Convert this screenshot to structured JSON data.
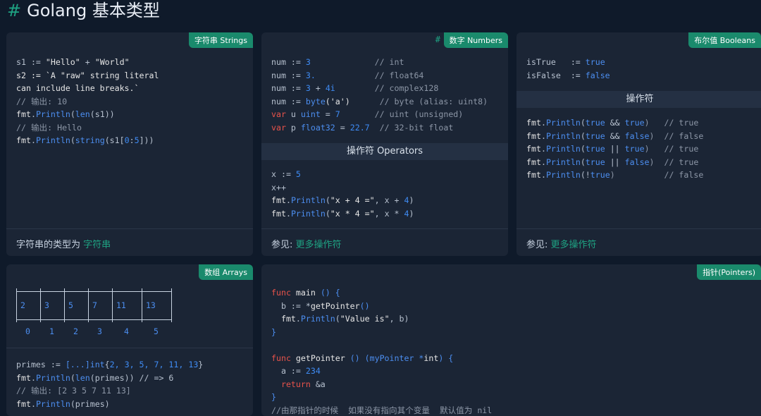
{
  "page_title": "Golang 基本类型",
  "page_title_hash": "#",
  "cards": {
    "strings": {
      "tag": "字符串 Strings",
      "code": [
        [
          {
            "t": "s1 := ",
            "c": "p"
          },
          {
            "t": "\"Hello\"",
            "c": "s"
          },
          {
            "t": " + ",
            "c": "p"
          },
          {
            "t": "\"World\"",
            "c": "s"
          }
        ],
        [
          {
            "t": "s2 := `A \"raw\" string literal",
            "c": "s"
          }
        ],
        [
          {
            "t": "can include line breaks.`",
            "c": "s"
          }
        ],
        [
          {
            "t": "// 输出: 10",
            "c": "c"
          }
        ],
        [
          {
            "t": "fmt",
            "c": "s"
          },
          {
            "t": ".",
            "c": "p"
          },
          {
            "t": "Println",
            "c": "f"
          },
          {
            "t": "(",
            "c": "p"
          },
          {
            "t": "len",
            "c": "f"
          },
          {
            "t": "(s1))",
            "c": "p"
          }
        ],
        [
          {
            "t": "// 输出: Hello",
            "c": "c"
          }
        ],
        [
          {
            "t": "fmt",
            "c": "s"
          },
          {
            "t": ".",
            "c": "p"
          },
          {
            "t": "Println",
            "c": "f"
          },
          {
            "t": "(",
            "c": "p"
          },
          {
            "t": "string",
            "c": "f"
          },
          {
            "t": "(s1[",
            "c": "p"
          },
          {
            "t": "0",
            "c": "n"
          },
          {
            "t": ":",
            "c": "p"
          },
          {
            "t": "5",
            "c": "n"
          },
          {
            "t": "]))",
            "c": "p"
          }
        ]
      ],
      "footer_text": "字符串的类型为 ",
      "footer_link": "字符串"
    },
    "numbers": {
      "tag": "数字 Numbers",
      "tag_hash": "#",
      "code": [
        [
          {
            "t": "num := ",
            "c": "p"
          },
          {
            "t": "3",
            "c": "n"
          },
          {
            "t": "             // int",
            "c": "c"
          }
        ],
        [
          {
            "t": "num := ",
            "c": "p"
          },
          {
            "t": "3.",
            "c": "n"
          },
          {
            "t": "            // float64",
            "c": "c"
          }
        ],
        [
          {
            "t": "num := ",
            "c": "p"
          },
          {
            "t": "3",
            "c": "n"
          },
          {
            "t": " + ",
            "c": "p"
          },
          {
            "t": "4i",
            "c": "n"
          },
          {
            "t": "        // complex128",
            "c": "c"
          }
        ],
        [
          {
            "t": "num := ",
            "c": "p"
          },
          {
            "t": "byte",
            "c": "f"
          },
          {
            "t": "('a')",
            "c": "s"
          },
          {
            "t": "      // byte (alias: uint8)",
            "c": "c"
          }
        ],
        [
          {
            "t": "var",
            "c": "k"
          },
          {
            "t": " u ",
            "c": "p"
          },
          {
            "t": "uint",
            "c": "f"
          },
          {
            "t": " = ",
            "c": "p"
          },
          {
            "t": "7",
            "c": "n"
          },
          {
            "t": "       // uint (unsigned)",
            "c": "c"
          }
        ],
        [
          {
            "t": "var",
            "c": "k"
          },
          {
            "t": " p ",
            "c": "p"
          },
          {
            "t": "float32",
            "c": "f"
          },
          {
            "t": " = ",
            "c": "p"
          },
          {
            "t": "22.7",
            "c": "n"
          },
          {
            "t": "  // 32-bit float",
            "c": "c"
          }
        ]
      ],
      "band": "操作符 Operators",
      "code2": [
        [
          {
            "t": "x := ",
            "c": "p"
          },
          {
            "t": "5",
            "c": "n"
          }
        ],
        [
          {
            "t": "x++",
            "c": "p"
          }
        ],
        [
          {
            "t": "fmt",
            "c": "s"
          },
          {
            "t": ".",
            "c": "p"
          },
          {
            "t": "Println",
            "c": "f"
          },
          {
            "t": "(",
            "c": "p"
          },
          {
            "t": "\"x + 4 =\"",
            "c": "s"
          },
          {
            "t": ", x + ",
            "c": "p"
          },
          {
            "t": "4",
            "c": "n"
          },
          {
            "t": ")",
            "c": "p"
          }
        ],
        [
          {
            "t": "fmt",
            "c": "s"
          },
          {
            "t": ".",
            "c": "p"
          },
          {
            "t": "Println",
            "c": "f"
          },
          {
            "t": "(",
            "c": "p"
          },
          {
            "t": "\"x * 4 =\"",
            "c": "s"
          },
          {
            "t": ", x * ",
            "c": "p"
          },
          {
            "t": "4",
            "c": "n"
          },
          {
            "t": ")",
            "c": "p"
          }
        ]
      ],
      "footer_text": "参见: ",
      "footer_link": "更多操作符"
    },
    "booleans": {
      "tag": "布尔值 Booleans",
      "code": [
        [
          {
            "t": "isTrue   := ",
            "c": "p"
          },
          {
            "t": "true",
            "c": "f"
          }
        ],
        [
          {
            "t": "isFalse  := ",
            "c": "p"
          },
          {
            "t": "false",
            "c": "f"
          }
        ]
      ],
      "band": "操作符",
      "code2": [
        [
          {
            "t": "fmt",
            "c": "s"
          },
          {
            "t": ".",
            "c": "p"
          },
          {
            "t": "Println",
            "c": "f"
          },
          {
            "t": "(",
            "c": "p"
          },
          {
            "t": "true",
            "c": "f"
          },
          {
            "t": " && ",
            "c": "p"
          },
          {
            "t": "true",
            "c": "f"
          },
          {
            "t": ")   // true",
            "c": "c"
          }
        ],
        [
          {
            "t": "fmt",
            "c": "s"
          },
          {
            "t": ".",
            "c": "p"
          },
          {
            "t": "Println",
            "c": "f"
          },
          {
            "t": "(",
            "c": "p"
          },
          {
            "t": "true",
            "c": "f"
          },
          {
            "t": " && ",
            "c": "p"
          },
          {
            "t": "false",
            "c": "f"
          },
          {
            "t": ")  // false",
            "c": "c"
          }
        ],
        [
          {
            "t": "fmt",
            "c": "s"
          },
          {
            "t": ".",
            "c": "p"
          },
          {
            "t": "Println",
            "c": "f"
          },
          {
            "t": "(",
            "c": "p"
          },
          {
            "t": "true",
            "c": "f"
          },
          {
            "t": " || ",
            "c": "p"
          },
          {
            "t": "true",
            "c": "f"
          },
          {
            "t": ")   // true",
            "c": "c"
          }
        ],
        [
          {
            "t": "fmt",
            "c": "s"
          },
          {
            "t": ".",
            "c": "p"
          },
          {
            "t": "Println",
            "c": "f"
          },
          {
            "t": "(",
            "c": "p"
          },
          {
            "t": "true",
            "c": "f"
          },
          {
            "t": " || ",
            "c": "p"
          },
          {
            "t": "false",
            "c": "f"
          },
          {
            "t": ")  // true",
            "c": "c"
          }
        ],
        [
          {
            "t": "fmt",
            "c": "s"
          },
          {
            "t": ".",
            "c": "p"
          },
          {
            "t": "Println",
            "c": "f"
          },
          {
            "t": "(!",
            "c": "p"
          },
          {
            "t": "true",
            "c": "f"
          },
          {
            "t": ")          // false",
            "c": "c"
          }
        ]
      ],
      "footer_text": "参见: ",
      "footer_link": "更多操作符"
    },
    "arrays": {
      "tag": "数组 Arrays",
      "values": [
        "2",
        "3",
        "5",
        "7",
        "11",
        "13"
      ],
      "indices": [
        "0",
        "1",
        "2",
        "3",
        "4",
        "5"
      ],
      "code": [
        [
          {
            "t": "primes := ",
            "c": "p"
          },
          {
            "t": "[...]",
            "c": "f"
          },
          {
            "t": "int",
            "c": "f"
          },
          {
            "t": "{",
            "c": "p"
          },
          {
            "t": "2, 3, 5, 7, 11, 13",
            "c": "n"
          },
          {
            "t": "}",
            "c": "p"
          }
        ],
        [
          {
            "t": "fmt",
            "c": "s"
          },
          {
            "t": ".",
            "c": "p"
          },
          {
            "t": "Println",
            "c": "f"
          },
          {
            "t": "(",
            "c": "p"
          },
          {
            "t": "len",
            "c": "f"
          },
          {
            "t": "(primes)) // => 6",
            "c": "p"
          }
        ],
        [
          {
            "t": "// 输出: [2 3 5 7 11 13]",
            "c": "c"
          }
        ],
        [
          {
            "t": "fmt",
            "c": "s"
          },
          {
            "t": ".",
            "c": "p"
          },
          {
            "t": "Println",
            "c": "f"
          },
          {
            "t": "(primes)",
            "c": "p"
          }
        ]
      ]
    },
    "pointers": {
      "tag": "指针(Pointers)",
      "code": [
        [
          {
            "t": "func",
            "c": "k"
          },
          {
            "t": " main ",
            "c": "s"
          },
          {
            "t": "() {",
            "c": "f"
          }
        ],
        [
          {
            "t": "  b := *",
            "c": "p"
          },
          {
            "t": "getPointer",
            "c": "s"
          },
          {
            "t": "()",
            "c": "f"
          }
        ],
        [
          {
            "t": "  fmt",
            "c": "s"
          },
          {
            "t": ".",
            "c": "p"
          },
          {
            "t": "Println",
            "c": "f"
          },
          {
            "t": "(",
            "c": "p"
          },
          {
            "t": "\"Value is\"",
            "c": "s"
          },
          {
            "t": ", b)",
            "c": "p"
          }
        ],
        [
          {
            "t": "}",
            "c": "f"
          }
        ],
        [
          {
            "t": "",
            "c": "p"
          }
        ],
        [
          {
            "t": "func",
            "c": "k"
          },
          {
            "t": " getPointer ",
            "c": "s"
          },
          {
            "t": "() (myPointer *",
            "c": "f"
          },
          {
            "t": "int",
            "c": "s"
          },
          {
            "t": ") {",
            "c": "f"
          }
        ],
        [
          {
            "t": "  a := ",
            "c": "p"
          },
          {
            "t": "234",
            "c": "n"
          }
        ],
        [
          {
            "t": "  return",
            "c": "k"
          },
          {
            "t": " &a",
            "c": "p"
          }
        ],
        [
          {
            "t": "}",
            "c": "f"
          }
        ],
        [
          {
            "t": "//由那指针的时候  如果没有指向其个变量  默认值为 nil",
            "c": "c"
          }
        ]
      ]
    }
  }
}
